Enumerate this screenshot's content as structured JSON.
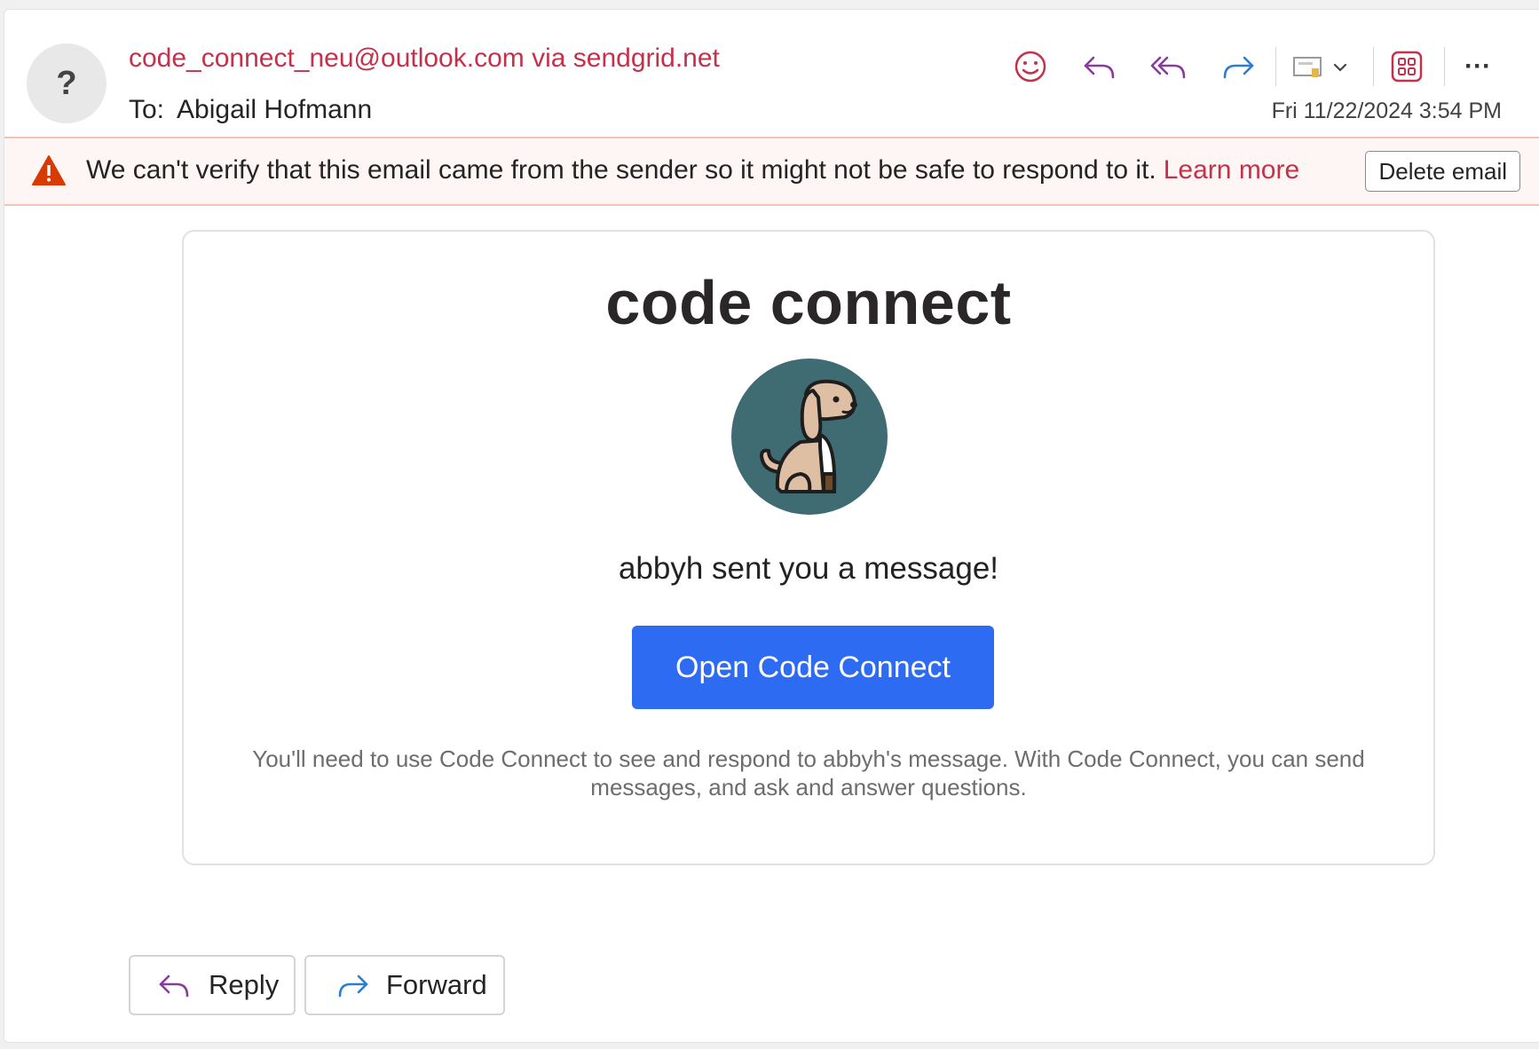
{
  "header": {
    "avatar_glyph": "?",
    "sender": "code_connect_neu@outlook.com via sendgrid.net",
    "to_label": "To:",
    "to_name": "Abigail Hofmann",
    "timestamp": "Fri 11/22/2024 3:54 PM"
  },
  "toolbar": {
    "icons": [
      "emoji-reaction-icon",
      "reply-icon",
      "reply-all-icon",
      "forward-icon",
      "tag-dropdown-icon",
      "apps-icon",
      "more-options-icon"
    ],
    "more_glyph": "···"
  },
  "warning": {
    "text": "We can't verify that this email came from the sender so it might not be safe to respond to it.",
    "learn_more": "Learn more",
    "delete_label": "Delete email"
  },
  "message": {
    "brand": "code connect",
    "headline": "abbyh sent you a message!",
    "cta_label": "Open Code Connect",
    "fine_print": "You'll need to use Code Connect to see and respond to abbyh's message. With Code Connect, you can send messages, and ask and answer questions."
  },
  "footer": {
    "reply_label": "Reply",
    "forward_label": "Forward"
  },
  "colors": {
    "sender_red": "#c4314b",
    "warning_bg": "#fdf6f4",
    "cta_blue": "#2d6cf2",
    "avatar_teal": "#3f6b73",
    "reply_purple": "#8a3a9e",
    "forward_blue": "#2b7cd3"
  }
}
